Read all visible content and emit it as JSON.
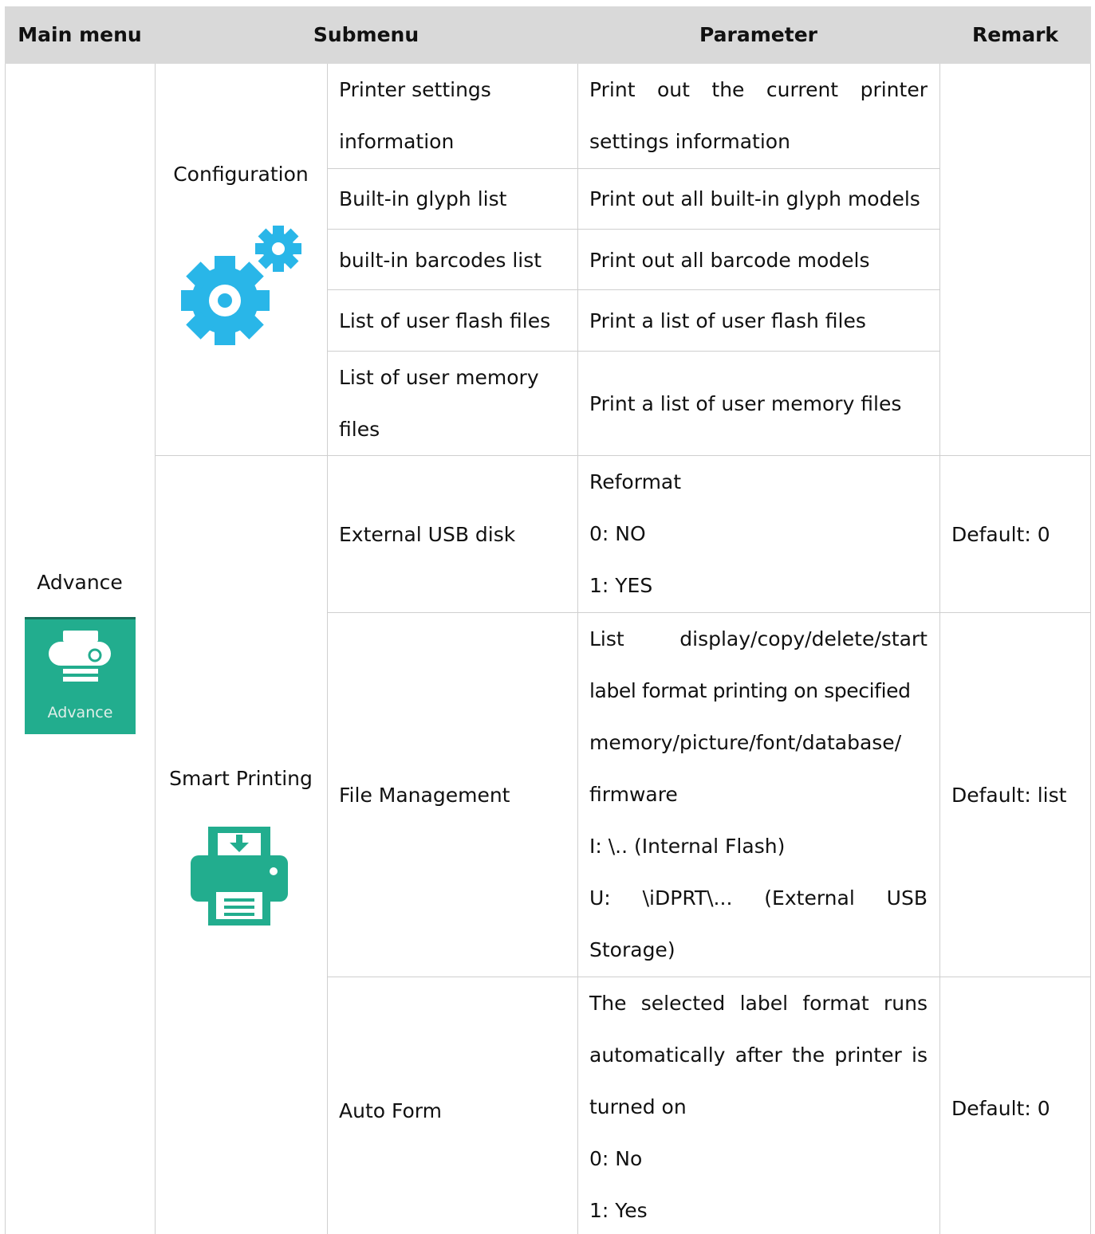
{
  "headers": {
    "main_menu": "Main menu",
    "submenu": "Submenu",
    "parameter": "Parameter",
    "remark": "Remark"
  },
  "main_menu": {
    "label": "Advance",
    "icon_label": "Advance",
    "icon_color": "#22ad8e"
  },
  "groups": {
    "configuration": {
      "label": "Configuration",
      "icon": "gears-icon",
      "icon_color": "#29b6e8",
      "rows": [
        {
          "submenu": [
            "Printer settings",
            "information"
          ],
          "parameter": [
            "Print out the current printer",
            "settings information"
          ]
        },
        {
          "submenu": [
            "Built-in glyph list"
          ],
          "parameter": [
            "Print out all built-in glyph models"
          ]
        },
        {
          "submenu": [
            "built-in barcodes list"
          ],
          "parameter": [
            "Print out all barcode models"
          ]
        },
        {
          "submenu": [
            "List of user flash files"
          ],
          "parameter": [
            "Print a list of user flash files"
          ]
        },
        {
          "submenu": [
            "List of user memory",
            "files"
          ],
          "parameter": [
            "Print a list of user memory files"
          ]
        }
      ]
    },
    "smart_printing": {
      "label": "Smart Printing",
      "icon": "printer-download-icon",
      "icon_color": "#22ad8e",
      "rows": [
        {
          "submenu": [
            "External USB disk"
          ],
          "parameter": [
            "Reformat",
            "0: NO",
            "1: YES"
          ],
          "remark": "Default: 0"
        },
        {
          "submenu": [
            "File Management"
          ],
          "parameter": [
            "List display/copy/delete/start",
            "label format printing on specified",
            "memory/picture/font/database/",
            "firmware",
            "I: \\.. (Internal Flash)",
            "U: \\iDPRT\\... (External USB",
            "Storage)"
          ],
          "remark": "Default: list"
        },
        {
          "submenu": [
            "Auto Form"
          ],
          "parameter": [
            "The selected label format runs",
            "automatically after the printer is",
            "turned on",
            "0: No",
            "1: Yes"
          ],
          "remark": "Default: 0"
        }
      ]
    }
  }
}
